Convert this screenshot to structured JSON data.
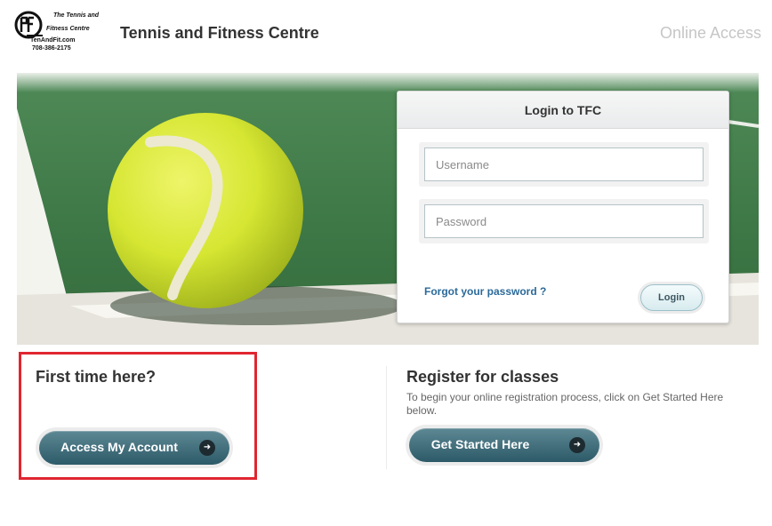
{
  "header": {
    "logo": {
      "line1": "The Tennis and",
      "line2": "Fitness Centre",
      "url": "TenAndFit.com",
      "phone": "708-386-2175"
    },
    "site_title": "Tennis and Fitness Centre",
    "online_access": "Online Access"
  },
  "hero": {
    "image": "tennis-ball-on-court"
  },
  "login": {
    "title": "Login to TFC",
    "username_placeholder": "Username",
    "password_placeholder": "Password",
    "username_value": "",
    "password_value": "",
    "forgot_link": "Forgot your password ?",
    "login_button": "Login"
  },
  "first_time": {
    "title": "First time here?",
    "button_label": "Access My Account",
    "button_icon": "arrow-right-icon"
  },
  "register": {
    "title": "Register for classes",
    "description": "To begin your online registration process, click on Get Started Here below.",
    "button_label": "Get Started Here",
    "button_icon": "arrow-right-icon"
  },
  "colors": {
    "highlight_border": "#e02630",
    "button_dark": "#2d5a68",
    "link": "#2b6a9a",
    "court_green": "#3f7a48",
    "ball_yellow": "#d6e632"
  }
}
